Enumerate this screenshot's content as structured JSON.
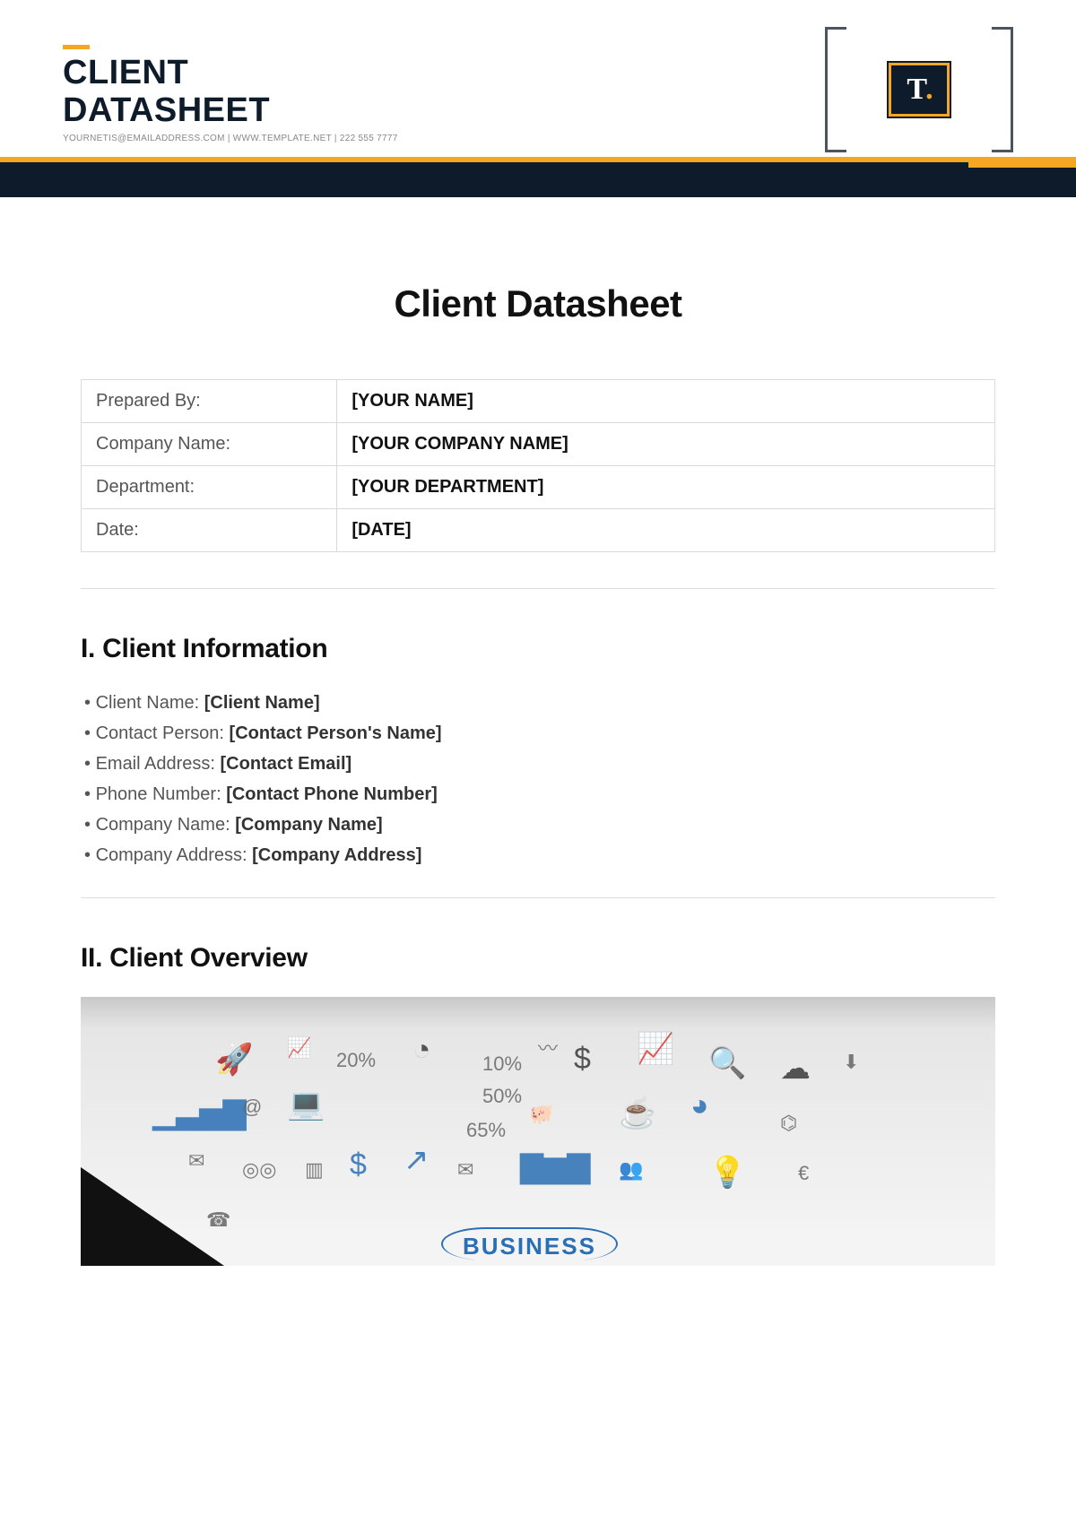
{
  "header": {
    "title_line1": "CLIENT",
    "title_line2": "DATASHEET",
    "subline": "YOURNETIS@EMAILADDRESS.COM | WWW.TEMPLATE.NET | 222 555 7777",
    "logo_text": "T",
    "logo_dot": "."
  },
  "doc_title": "Client Datasheet",
  "meta_rows": [
    {
      "label": "Prepared By:",
      "value": "[YOUR NAME]"
    },
    {
      "label": "Company Name:",
      "value": "[YOUR COMPANY NAME]"
    },
    {
      "label": "Department:",
      "value": "[YOUR DEPARTMENT]"
    },
    {
      "label": "Date:",
      "value": "[DATE]"
    }
  ],
  "section1": {
    "heading": "I. Client Information",
    "items": [
      {
        "label": "Client Name: ",
        "value": "[Client Name]"
      },
      {
        "label": "Contact Person: ",
        "value": "[Contact Person's Name]"
      },
      {
        "label": "Email Address: ",
        "value": "[Contact Email]"
      },
      {
        "label": "Phone Number: ",
        "value": "[Contact Phone Number]"
      },
      {
        "label": "Company Name: ",
        "value": "[Company Name]"
      },
      {
        "label": "Company Address: ",
        "value": "[Company Address]"
      }
    ]
  },
  "section2": {
    "heading": "II. Client Overview",
    "banner_word": "BUSINESS",
    "annotations": [
      "20%",
      "10%",
      "50%",
      "65%"
    ]
  }
}
